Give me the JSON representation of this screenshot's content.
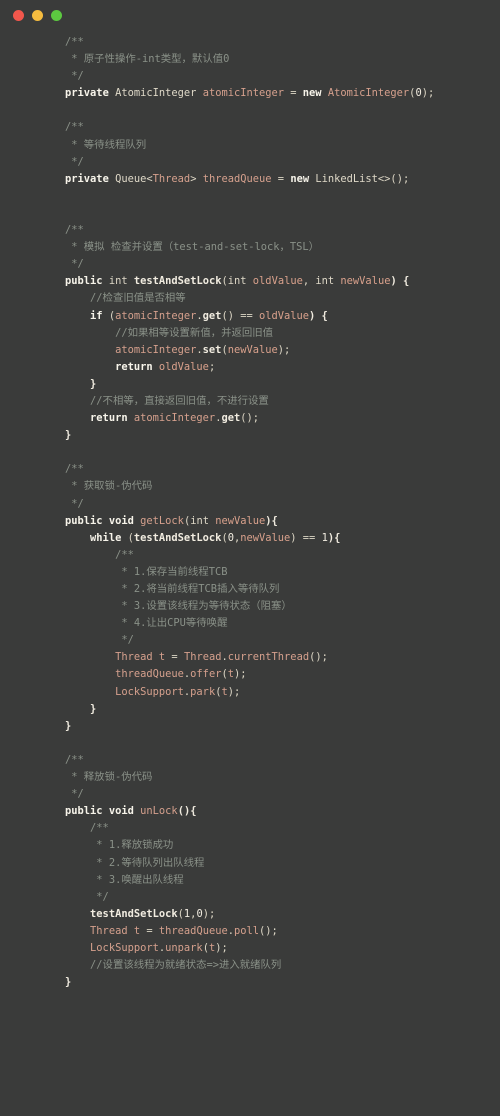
{
  "window": {
    "traffic_lights": [
      {
        "name": "close-button",
        "color": "#f2574c"
      },
      {
        "name": "minimize-button",
        "color": "#f5bc3f"
      },
      {
        "name": "maximize-button",
        "color": "#5cc940"
      }
    ],
    "background": "#3a3b3a",
    "page_background": "#2f3032"
  },
  "editor": {
    "language": "java",
    "theme": {
      "comment": "#8a9188",
      "keyword": "#f7f4ea",
      "type": "#dfd9c8",
      "variable": "#d9a18c",
      "method": "#f1ece0",
      "number": "#f1ece0",
      "foreground": "#e8e2d4"
    },
    "lines": [
      "    /**",
      "     * 原子性操作-int类型，默认值0",
      "     */",
      "    private AtomicInteger atomicInteger = new AtomicInteger(0);",
      "",
      "    /**",
      "     * 等待线程队列",
      "     */",
      "    private Queue<Thread> threadQueue = new LinkedList<>();",
      "",
      "",
      "    /**",
      "     * 模拟 检查并设置（test-and-set-lock，TSL）",
      "     */",
      "    public int testAndSetLock(int oldValue, int newValue) {",
      "        //检查旧值是否相等",
      "        if (atomicInteger.get() == oldValue) {",
      "            //如果相等设置新值，并返回旧值",
      "            atomicInteger.set(newValue);",
      "            return oldValue;",
      "        }",
      "        //不相等，直接返回旧值，不进行设置",
      "        return atomicInteger.get();",
      "    }",
      "",
      "    /**",
      "     * 获取锁-伪代码",
      "     */",
      "    public void getLock(int newValue){",
      "        while (testAndSetLock(0,newValue) == 1){",
      "            /**",
      "             * 1.保存当前线程TCB",
      "             * 2.将当前线程TCB插入等待队列",
      "             * 3.设置该线程为等待状态（阻塞）",
      "             * 4.让出CPU等待唤醒",
      "             */",
      "            Thread t = Thread.currentThread();",
      "            threadQueue.offer(t);",
      "            LockSupport.park(t);",
      "        }",
      "    }",
      "",
      "    /**",
      "     * 释放锁-伪代码",
      "     */",
      "    public void unLock(){",
      "        /**",
      "         * 1.释放锁成功",
      "         * 2.等待队列出队线程",
      "         * 3.唤醒出队线程",
      "         */",
      "        testAndSetLock(1,0);",
      "        Thread t = threadQueue.poll();",
      "        LockSupport.unpark(t);",
      "        //设置该线程为就绪状态=>进入就绪队列",
      "    }"
    ]
  }
}
